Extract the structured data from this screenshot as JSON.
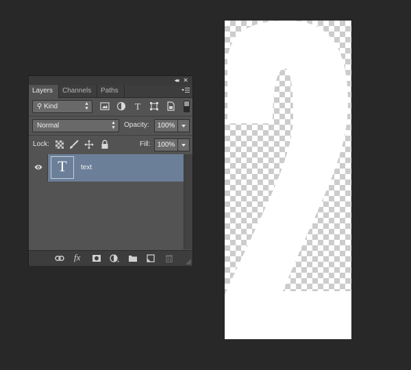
{
  "panel": {
    "tabs": [
      {
        "label": "Layers",
        "active": true
      },
      {
        "label": "Channels",
        "active": false
      },
      {
        "label": "Paths",
        "active": false
      }
    ],
    "filter": {
      "kind_label": "Kind",
      "icons": [
        "image-filter-icon",
        "adjustment-filter-icon",
        "type-filter-icon",
        "shape-filter-icon",
        "smart-object-filter-icon"
      ]
    },
    "blend_mode": "Normal",
    "opacity_label": "Opacity:",
    "opacity_value": "100%",
    "lock_label": "Lock:",
    "fill_label": "Fill:",
    "fill_value": "100%",
    "layers": [
      {
        "name": "text",
        "type_glyph": "T",
        "visible": true,
        "selected": true
      }
    ],
    "bottom_icons": [
      "link-icon",
      "fx-icon",
      "mask-icon",
      "adjustment-layer-icon",
      "folder-icon",
      "new-layer-icon",
      "trash-icon"
    ],
    "fx_label": "fx"
  },
  "canvas": {
    "glyph": "2",
    "glyph_color": "#ffffff",
    "transparency_colors": [
      "#ffffff",
      "#cccccc"
    ]
  },
  "colors": {
    "background": "#282828",
    "panel": "#535353",
    "selected_layer": "#6c7f99"
  }
}
